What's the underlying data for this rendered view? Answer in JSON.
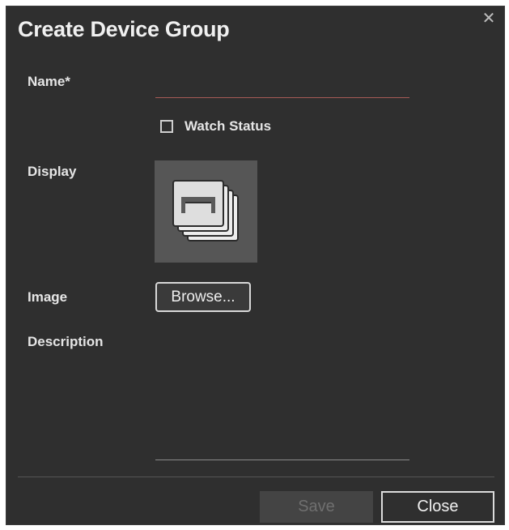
{
  "dialog": {
    "title": "Create Device Group",
    "close_icon": "close-icon",
    "close_glyph": "✕"
  },
  "form": {
    "name_label": "Name*",
    "name_value": "",
    "watch_status_label": "Watch Status",
    "watch_status_checked": false,
    "display_label": "Display",
    "display_icon": "stacked-devices-icon",
    "image_label": "Image",
    "browse_label": "Browse...",
    "description_label": "Description",
    "description_value": ""
  },
  "footer": {
    "save_label": "Save",
    "save_enabled": false,
    "close_label": "Close"
  },
  "colors": {
    "dialog_bg": "#2f2f2f",
    "tile_bg": "#565656",
    "name_underline": "#a65a56",
    "disabled_button_bg": "#444444"
  }
}
